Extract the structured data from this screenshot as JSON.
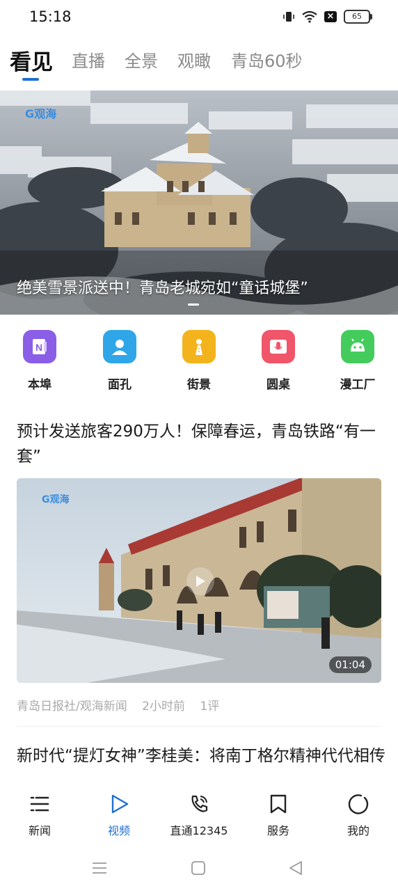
{
  "status_bar": {
    "time": "15:18",
    "battery": "65"
  },
  "top_tabs": [
    {
      "label": "看见",
      "active": true
    },
    {
      "label": "直播"
    },
    {
      "label": "全景"
    },
    {
      "label": "观瞰"
    },
    {
      "label": "青岛60秒"
    }
  ],
  "hero": {
    "caption": "绝美雪景派送中！青岛老城宛如“童话城堡”",
    "logo": "G观海"
  },
  "quick_links": [
    {
      "label": "本埠",
      "icon": "note-icon",
      "color": "#8a5ee6"
    },
    {
      "label": "面孔",
      "icon": "person-icon",
      "color": "#2fa6e8"
    },
    {
      "label": "街景",
      "icon": "road-icon",
      "color": "#f3b31c"
    },
    {
      "label": "圆桌",
      "icon": "microphone-icon",
      "color": "#f0556a"
    },
    {
      "label": "漫工厂",
      "icon": "robot-icon",
      "color": "#43cc5c"
    }
  ],
  "articles": [
    {
      "title": "预计发送旅客290万人！保障春运，青岛铁路“有一套”",
      "duration": "01:04",
      "source": "青岛日报社/观海新闻",
      "time": "2小时前",
      "comments": "1评",
      "logo": "G观海"
    },
    {
      "title": "新时代“提灯女神”李桂美：将南丁格尔精神代代相传"
    }
  ],
  "bottom_nav": [
    {
      "label": "新闻",
      "icon": "news-list-icon"
    },
    {
      "label": "视频",
      "icon": "play-icon",
      "active": true
    },
    {
      "label": "直通12345",
      "icon": "phone-icon"
    },
    {
      "label": "服务",
      "icon": "bookmark-icon"
    },
    {
      "label": "我的",
      "icon": "profile-circle-icon"
    }
  ],
  "colors": {
    "accent": "#1e6fd0",
    "muted": "#8a8a8a"
  }
}
